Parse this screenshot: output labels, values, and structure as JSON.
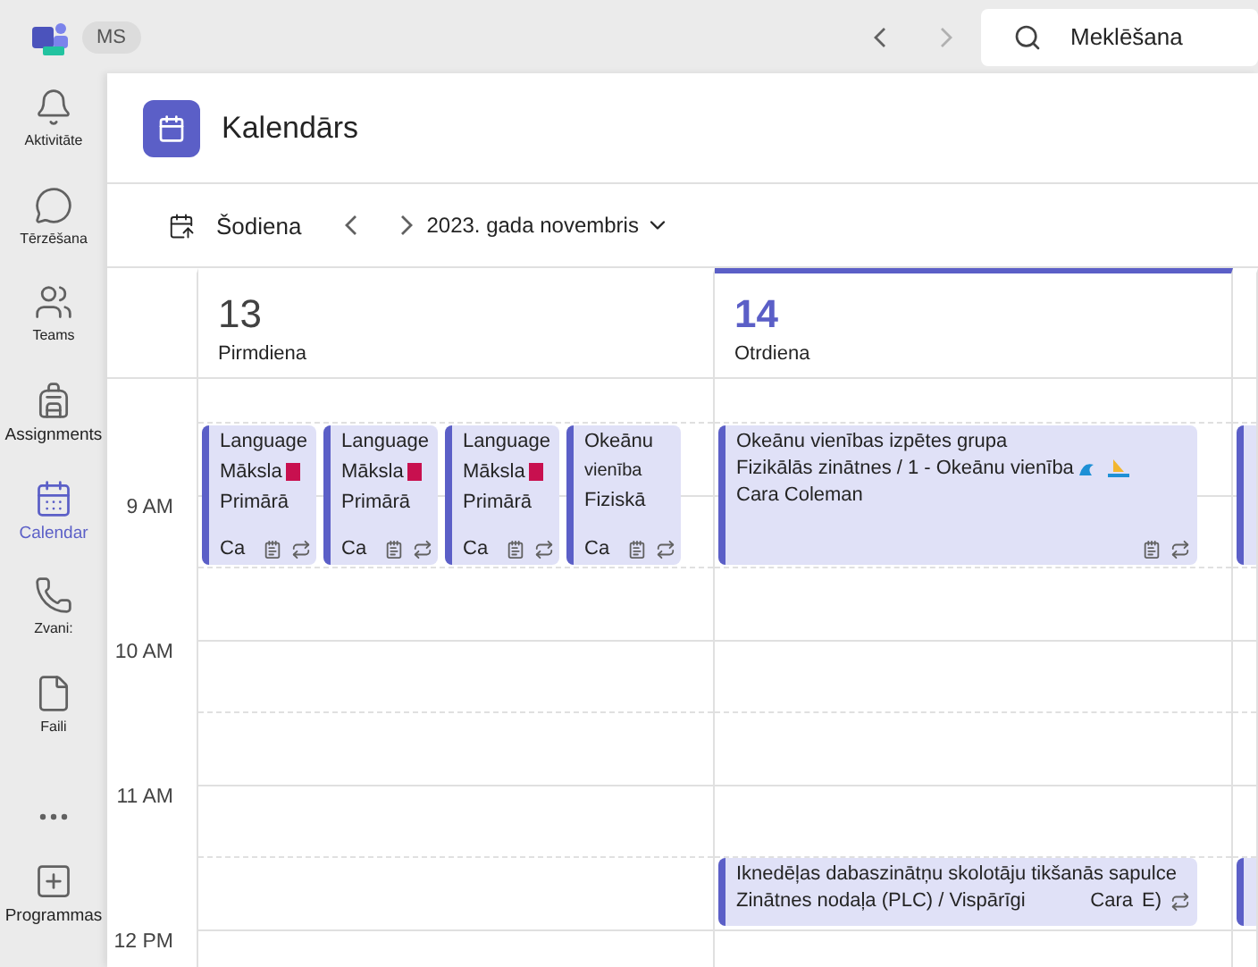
{
  "top_bar": {
    "profile_badge": "MS",
    "search": {
      "placeholder": "Meklēšana"
    }
  },
  "sidebar": {
    "items": [
      {
        "kind": "bell",
        "label": "Aktivitāte",
        "selected": false
      },
      {
        "kind": "chat",
        "label": "Tērzēšana",
        "selected": false
      },
      {
        "kind": "teams",
        "label": "Teams",
        "selected": false
      },
      {
        "kind": "backpack",
        "label": "Assignments",
        "selected": false
      },
      {
        "kind": "calendar",
        "label": "Calendar",
        "selected": true
      },
      {
        "kind": "phone",
        "label": "Zvani:",
        "selected": false
      },
      {
        "kind": "file",
        "label": "Faili",
        "selected": false
      },
      {
        "kind": "more"
      },
      {
        "kind": "apps",
        "label": "Programmas",
        "selected": false
      }
    ]
  },
  "page": {
    "title": "Kalendārs"
  },
  "toolbar": {
    "today": "Šodiena",
    "month": "2023. gada novembris"
  },
  "times": [
    "9 AM",
    "10 AM",
    "11 AM",
    "12 PM"
  ],
  "days": [
    {
      "number": "13",
      "name": "Pirmdiena",
      "selected": false,
      "blocks": [
        {
          "events": [
            {
              "lines": [
                "Language",
                "Māksla",
                "Primārā"
              ],
              "flag": true,
              "person": "Ca",
              "kind": "narrow"
            },
            {
              "lines": [
                "Language",
                "Māksla",
                "Primārā"
              ],
              "flag": true,
              "person": "Ca",
              "kind": "narrow"
            },
            {
              "lines": [
                "Language",
                "Māksla",
                "Primārā"
              ],
              "flag": true,
              "person": "Ca",
              "kind": "narrow"
            },
            {
              "lines": [
                "Okeānu",
                "vienība",
                "Fiziskā"
              ],
              "flag": false,
              "person": "Ca",
              "kind": "narrow"
            }
          ]
        }
      ]
    },
    {
      "number": "14",
      "name": "Otrdiena",
      "selected": true,
      "blocks": [
        {
          "events": [
            {
              "lines": [
                "Okeānu vienības izpētes grupa",
                "Fizikālās zinātnes / 1 - Okeānu vienība"
              ],
              "person": "Cara Coleman",
              "emoji": true,
              "kind": "wide"
            }
          ]
        },
        {
          "events": [
            {
              "lines": [
                "Iknedēļas dabaszinātņu skolotāju tikšanās sapulce",
                "Zinātnes nodaļa (PLC) / Vispārīgi"
              ],
              "person": "Cara",
              "extra": "E)",
              "kind": "short"
            }
          ]
        }
      ]
    },
    {
      "selected": false,
      "blocks": [
        {
          "events": [
            {
              "kind": "cut"
            }
          ]
        },
        {
          "events": [
            {
              "kind": "cut"
            }
          ]
        }
      ]
    }
  ]
}
